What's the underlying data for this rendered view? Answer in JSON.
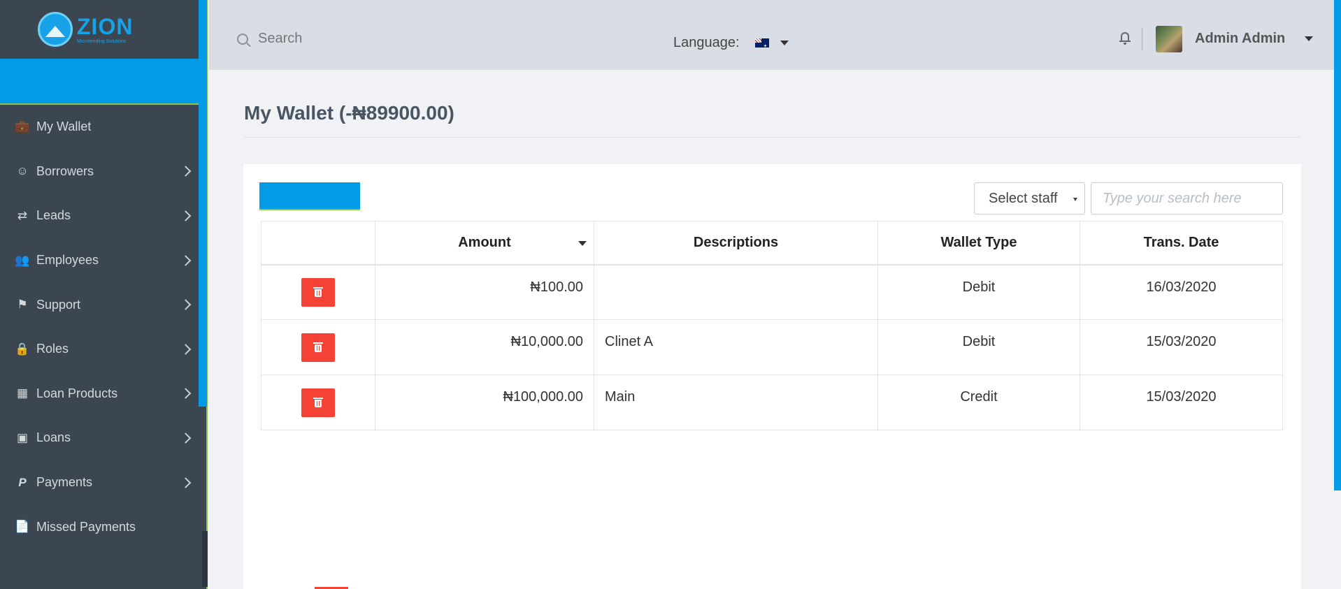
{
  "brand": {
    "name": "ZION",
    "tagline": "Microlending Solutions"
  },
  "sidebar": {
    "items": [
      {
        "label": "My Wallet",
        "icon": "briefcase-icon",
        "has_submenu": false
      },
      {
        "label": "Borrowers",
        "icon": "smiley-icon",
        "has_submenu": true
      },
      {
        "label": "Leads",
        "icon": "shuffle-icon",
        "has_submenu": true
      },
      {
        "label": "Employees",
        "icon": "users-icon",
        "has_submenu": true
      },
      {
        "label": "Support",
        "icon": "bookmark-icon",
        "has_submenu": true
      },
      {
        "label": "Roles",
        "icon": "lock-icon",
        "has_submenu": true
      },
      {
        "label": "Loan Products",
        "icon": "table-icon",
        "has_submenu": true
      },
      {
        "label": "Loans",
        "icon": "money-icon",
        "has_submenu": true
      },
      {
        "label": "Payments",
        "icon": "paypal-icon",
        "has_submenu": true
      },
      {
        "label": "Missed Payments",
        "icon": "file-icon",
        "has_submenu": false
      }
    ]
  },
  "header": {
    "search_label": "Search",
    "language_label": "Language:",
    "language_flag": "australia-flag",
    "user_name": "Admin Admin"
  },
  "page": {
    "title": "My Wallet (-₦89900.00)"
  },
  "filters": {
    "staff_select": "Select staff",
    "search_placeholder": "Type your search here"
  },
  "table": {
    "headers": [
      "",
      "Amount",
      "Descriptions",
      "Wallet Type",
      "Trans. Date"
    ],
    "rows": [
      {
        "amount": "₦100.00",
        "description": "",
        "type": "Debit",
        "date": "16/03/2020"
      },
      {
        "amount": "₦10,000.00",
        "description": "Clinet A",
        "type": "Debit",
        "date": "15/03/2020"
      },
      {
        "amount": "₦100,000.00",
        "description": "Main",
        "type": "Credit",
        "date": "15/03/2020"
      }
    ]
  },
  "colors": {
    "accent": "#039be5",
    "sidebar": "#3b4650",
    "danger": "#f44336",
    "header": "#d9dee6"
  }
}
